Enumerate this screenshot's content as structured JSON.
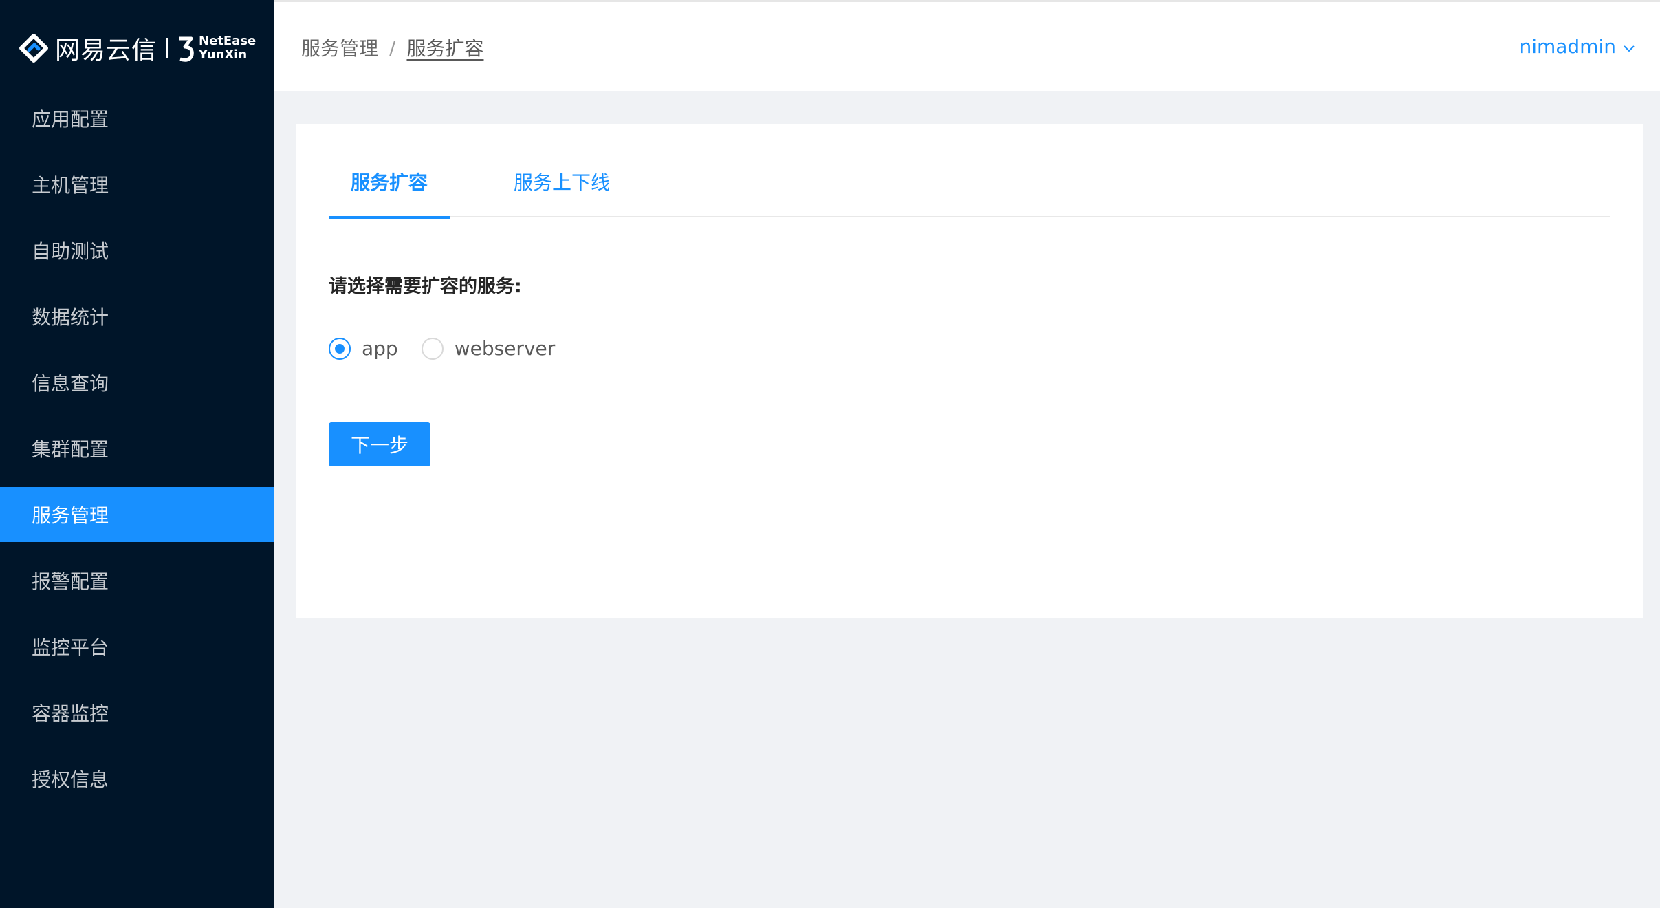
{
  "brand": {
    "name_cn": "网易云信",
    "name_en_line1": "NetEase",
    "name_en_line2": "YunXin",
    "logo_icon": "netease-yunxin-logo-icon"
  },
  "sidebar": {
    "items": [
      {
        "label": "应用配置"
      },
      {
        "label": "主机管理"
      },
      {
        "label": "自助测试"
      },
      {
        "label": "数据统计"
      },
      {
        "label": "信息查询"
      },
      {
        "label": "集群配置"
      },
      {
        "label": "服务管理",
        "active": true
      },
      {
        "label": "报警配置"
      },
      {
        "label": "监控平台"
      },
      {
        "label": "容器监控"
      },
      {
        "label": "授权信息"
      }
    ]
  },
  "header": {
    "breadcrumb": {
      "parent": "服务管理",
      "separator": "/",
      "current": "服务扩容"
    },
    "user": {
      "name": "nimadmin",
      "icon": "chevron-down-icon"
    }
  },
  "main": {
    "tabs": [
      {
        "label": "服务扩容",
        "active": true
      },
      {
        "label": "服务上下线"
      }
    ],
    "prompt": "请选择需要扩容的服务:",
    "options": [
      {
        "label": "app",
        "checked": true
      },
      {
        "label": "webserver",
        "checked": false
      }
    ],
    "next_button": "下一步"
  },
  "colors": {
    "sidebar_bg": "#001529",
    "accent": "#1890ff",
    "page_bg": "#f0f2f5"
  }
}
